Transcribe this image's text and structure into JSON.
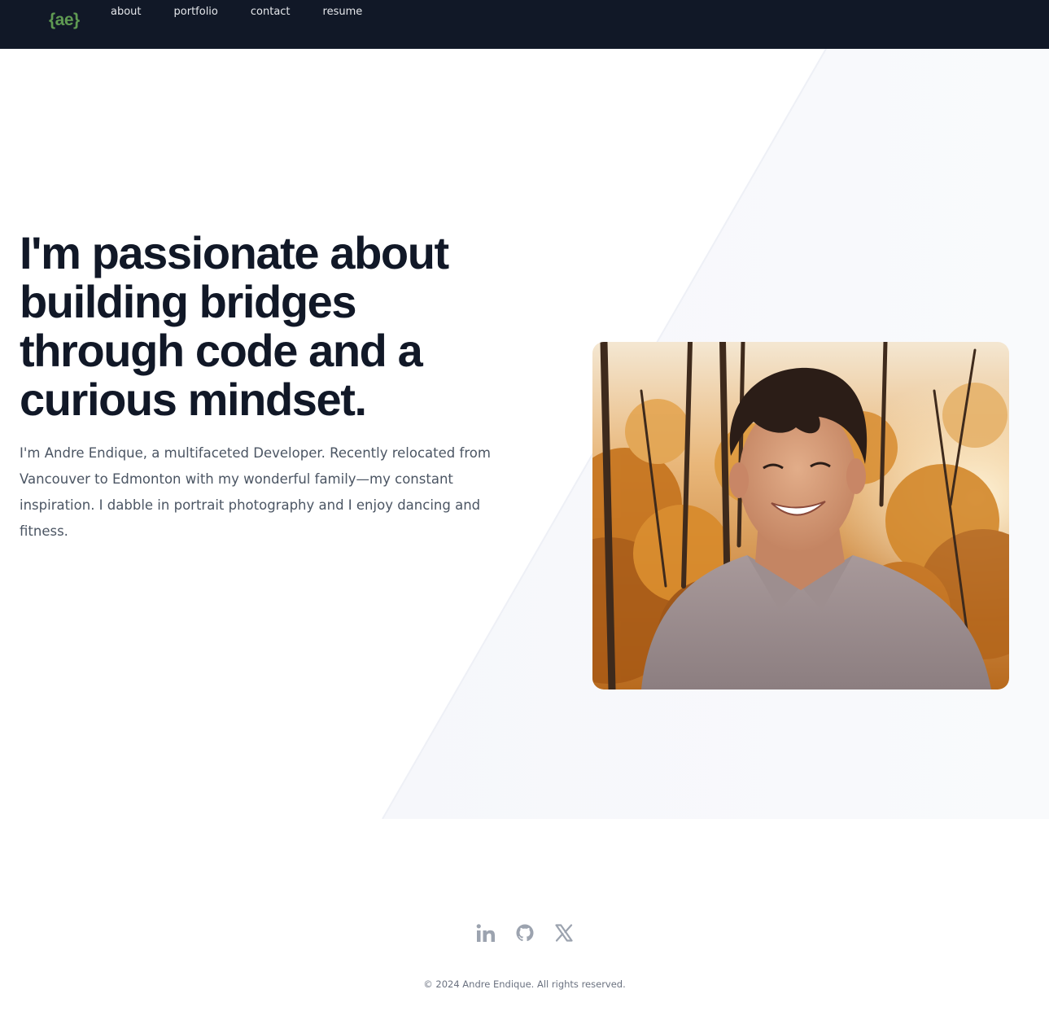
{
  "nav": {
    "logo": "{ae}",
    "links": [
      "about",
      "portfolio",
      "contact",
      "resume"
    ]
  },
  "hero": {
    "headline": "I'm passionate about building bridges through code and a curious mindset.",
    "bio": "I'm Andre Endique, a multifaceted Developer. Recently relocated from Vancouver to Edmonton with my wonderful family—my constant inspiration. I dabble in portrait photography and I enjoy dancing and fitness."
  },
  "social": {
    "icons": [
      "linkedin-icon",
      "github-icon",
      "x-icon"
    ]
  },
  "footer": {
    "copyright": "© 2024 Andre Endique. All rights reserved."
  },
  "colors": {
    "nav_bg": "#111827",
    "logo": "#5f9a52",
    "headline": "#111827",
    "body_text": "#4b5563",
    "icon": "#9ca3af"
  }
}
